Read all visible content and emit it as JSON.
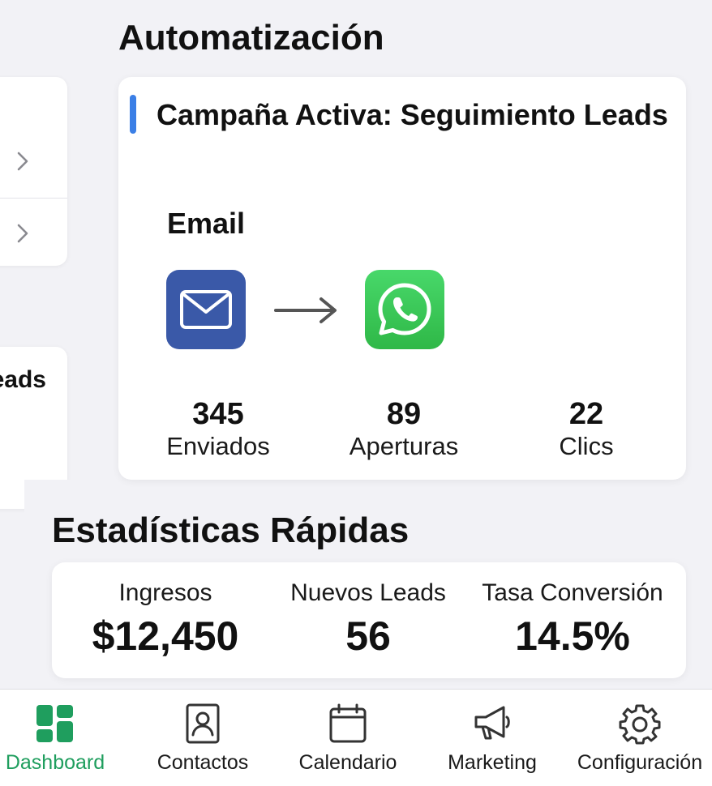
{
  "automation": {
    "title": "Automatización",
    "campaign": {
      "title": "Campaña Activa: Seguimiento Leads",
      "channel_label": "Email",
      "metrics": [
        {
          "value": "345",
          "label": "Enviados"
        },
        {
          "value": "89",
          "label": "Aperturas"
        },
        {
          "value": "22",
          "label": "Clics"
        }
      ]
    }
  },
  "left_panel": {
    "clipped_text": "eads"
  },
  "stats": {
    "title": "Estadísticas Rápidas",
    "items": [
      {
        "label": "Ingresos",
        "value": "$12,450"
      },
      {
        "label": "Nuevos Leads",
        "value": "56"
      },
      {
        "label": "Tasa Conversión",
        "value": "14.5%"
      }
    ]
  },
  "nav": {
    "active": "Dashboard",
    "items": [
      {
        "label": "Dashboard",
        "icon": "dashboard-icon"
      },
      {
        "label": "Contactos",
        "icon": "contacts-icon"
      },
      {
        "label": "Calendario",
        "icon": "calendar-icon"
      },
      {
        "label": "Marketing",
        "icon": "megaphone-icon"
      },
      {
        "label": "Configuración",
        "icon": "gear-icon"
      }
    ]
  },
  "colors": {
    "accent_blue": "#3b7fe6",
    "email_blue": "#3a59a8",
    "whatsapp_green": "#2fb847",
    "active_green": "#1f9e5e"
  }
}
